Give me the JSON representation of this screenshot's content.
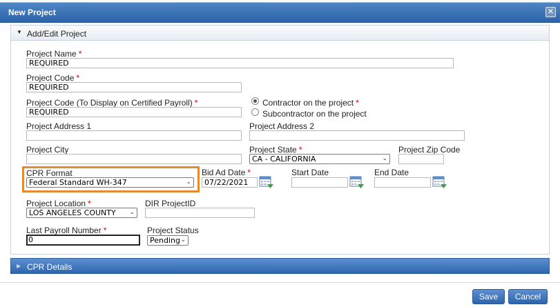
{
  "dialog": {
    "title": "New Project",
    "close_glyph": "✕"
  },
  "section_add_edit": {
    "label": "Add/Edit Project",
    "expanded": true
  },
  "form": {
    "project_name": {
      "label": "Project Name",
      "required_mark": "*",
      "value": "REQUIRED"
    },
    "project_code": {
      "label": "Project Code",
      "required_mark": "*",
      "value": "REQUIRED"
    },
    "project_code_display": {
      "label": "Project Code (To Display on Certified Payroll)",
      "required_mark": "*",
      "value": "REQUIRED"
    },
    "contractor_role": {
      "options": [
        {
          "label": "Contractor on the project",
          "required_mark": "*",
          "selected": true
        },
        {
          "label": "Subcontractor on the project",
          "selected": false
        }
      ]
    },
    "project_address_1": {
      "label": "Project Address 1",
      "value": ""
    },
    "project_address_2": {
      "label": "Project Address 2",
      "value": ""
    },
    "project_city": {
      "label": "Project City",
      "value": ""
    },
    "project_state": {
      "label": "Project State",
      "required_mark": "*",
      "value": "CA - CALIFORNIA"
    },
    "project_zip": {
      "label": "Project Zip Code",
      "value": ""
    },
    "cpr_format": {
      "label": "CPR Format",
      "value": "Federal Standard WH-347"
    },
    "bid_ad_date": {
      "label": "Bid Ad Date",
      "required_mark": "*",
      "value": "07/22/2021"
    },
    "start_date": {
      "label": "Start Date",
      "value": ""
    },
    "end_date": {
      "label": "End Date",
      "value": ""
    },
    "project_location": {
      "label": "Project Location",
      "required_mark": "*",
      "value": "LOS ANGELES COUNTY"
    },
    "dir_project_id": {
      "label": "DIR ProjectID",
      "value": ""
    },
    "last_payroll_number": {
      "label": "Last Payroll Number",
      "required_mark": "*",
      "value": "0"
    },
    "project_status": {
      "label": "Project Status",
      "value": "Pending"
    }
  },
  "section_cpr_details": {
    "label": "CPR Details",
    "expanded": false
  },
  "footer": {
    "save_label": "Save",
    "cancel_label": "Cancel"
  },
  "icons": {
    "expanded_arrow": "caret-down-icon",
    "collapsed_arrow": "caret-right-icon",
    "calendar": "calendar-icon",
    "dropdown": "chevron-down-icon"
  },
  "colors": {
    "title_bar": "#2d63a8",
    "button": "#3a6fb5",
    "required": "#cc0000",
    "highlight": "#e48a2f"
  }
}
